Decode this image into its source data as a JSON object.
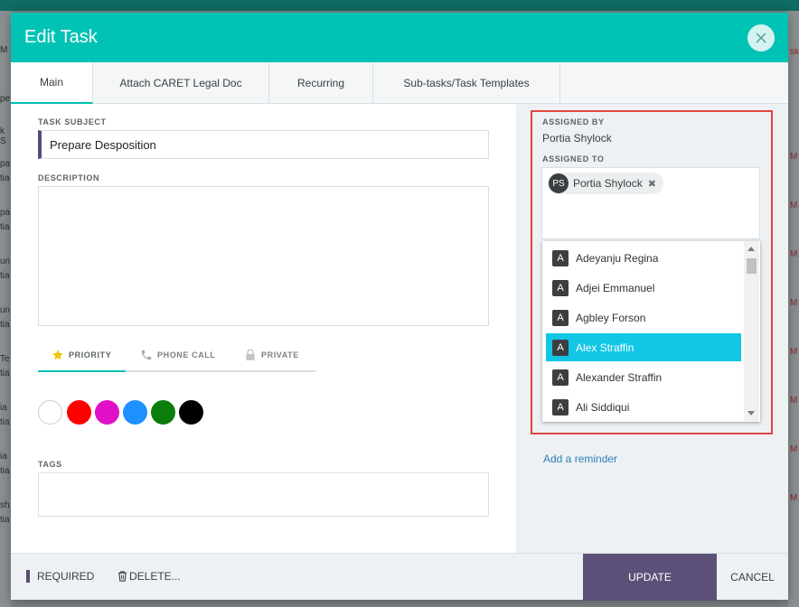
{
  "background": {
    "left_fragments": [
      "M",
      "pe",
      "k S",
      "pa",
      "tia",
      "pa",
      "tia",
      "un",
      "tia",
      "un",
      "tia",
      "Te",
      "tia",
      "ia",
      "tia",
      "ia",
      "tia",
      "sh",
      "tia"
    ],
    "right_fragments": [
      "sk",
      "M",
      "M",
      "M",
      "M",
      "M",
      "M",
      "M",
      "M"
    ]
  },
  "modal": {
    "title": "Edit Task",
    "close_icon": "close-icon",
    "tabs": [
      {
        "label": "Main",
        "active": true
      },
      {
        "label": "Attach CARET Legal Doc",
        "active": false
      },
      {
        "label": "Recurring",
        "active": false
      },
      {
        "label": "Sub-tasks/Task Templates",
        "active": false
      }
    ]
  },
  "form": {
    "subject_label": "TASK SUBJECT",
    "subject_value": "Prepare Desposition",
    "description_label": "DESCRIPTION",
    "description_value": "",
    "options": [
      {
        "label": "PRIORITY",
        "icon": "star-icon",
        "active": true
      },
      {
        "label": "PHONE CALL",
        "icon": "phone-icon",
        "active": false
      },
      {
        "label": "PRIVATE",
        "icon": "lock-icon",
        "active": false
      }
    ],
    "colors": [
      "#ffffff",
      "#ff0000",
      "#e10fc5",
      "#1e90ff",
      "#0a7d0a",
      "#000000"
    ],
    "tags_label": "TAGS",
    "tags_value": ""
  },
  "assignment": {
    "assigned_by_label": "ASSIGNED BY",
    "assigned_by_value": "Portia Shylock",
    "assigned_to_label": "ASSIGNED TO",
    "chip": {
      "initials": "PS",
      "name": "Portia Shylock",
      "remove_icon": "remove-icon"
    },
    "dropdown_items": [
      {
        "initial": "A",
        "name": "Adeyanju Regina",
        "selected": false
      },
      {
        "initial": "A",
        "name": "Adjei Emmanuel",
        "selected": false
      },
      {
        "initial": "A",
        "name": "Agbley Forson",
        "selected": false
      },
      {
        "initial": "A",
        "name": "Alex Straffin",
        "selected": true
      },
      {
        "initial": "A",
        "name": "Alexander Straffin",
        "selected": false
      },
      {
        "initial": "A",
        "name": "Ali Siddiqui",
        "selected": false
      }
    ],
    "reminder_link": "Add a reminder",
    "highlight_color": "#e0463f"
  },
  "footer": {
    "required_label": "REQUIRED",
    "delete_label": "DELETE...",
    "delete_icon": "trash-icon",
    "update_label": "UPDATE",
    "cancel_label": "CANCEL"
  },
  "colors": {
    "header": "#00c2b5",
    "primary_button": "#5c5078",
    "required_accent": "#574a7a",
    "selected_item": "#12c6e6",
    "link": "#2a7fb8"
  }
}
